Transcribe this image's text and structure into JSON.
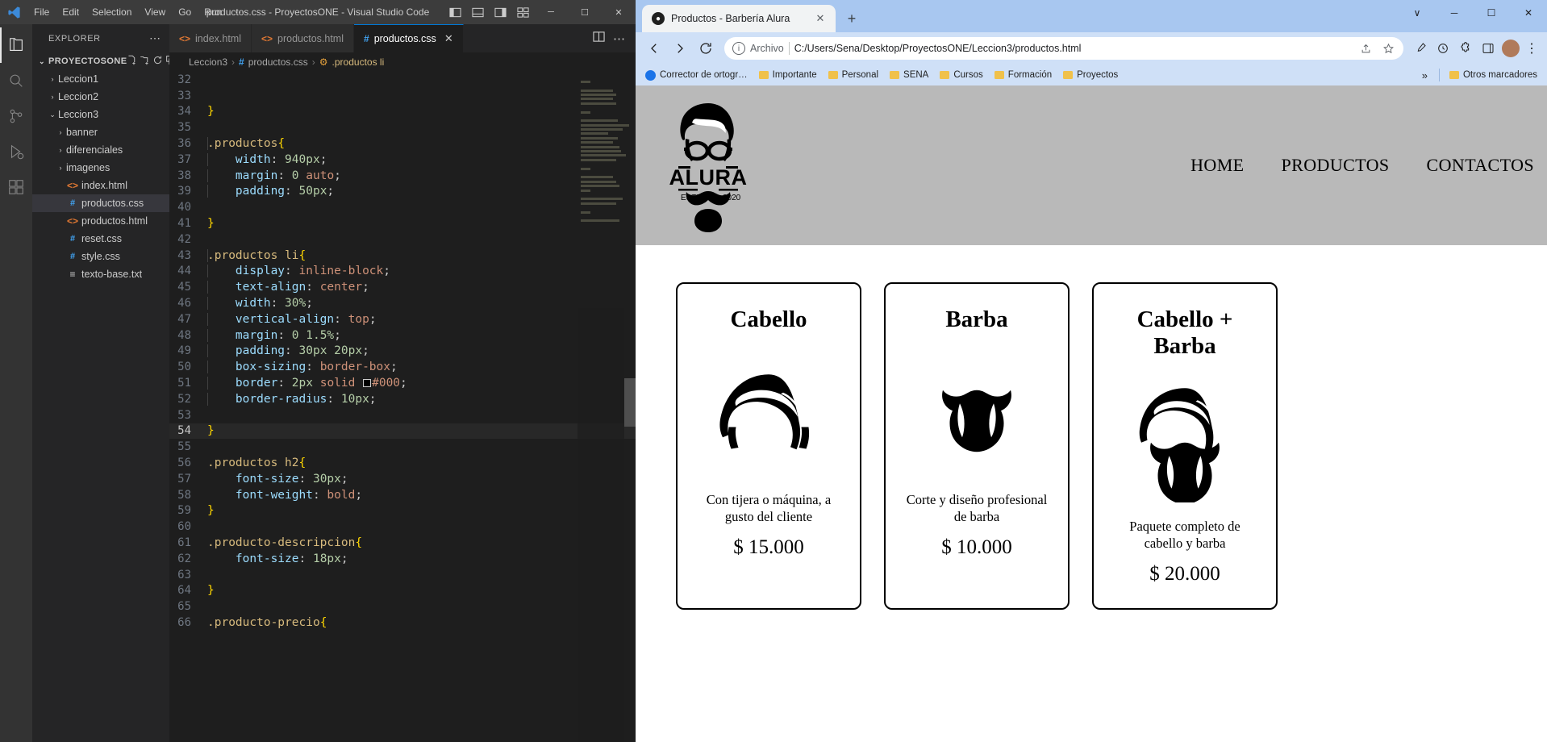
{
  "vscode": {
    "title": "productos.css - ProyectosONE - Visual Studio Code",
    "menu": [
      "File",
      "Edit",
      "Selection",
      "View",
      "Go",
      "Run",
      "⋯"
    ],
    "window_buttons": {
      "minimize": "─",
      "maximize": "☐",
      "close": "✕"
    },
    "activity_items": [
      "explorer-icon",
      "search-icon",
      "source-control-icon",
      "run-debug-icon",
      "extensions-icon"
    ],
    "sidebar": {
      "header": "EXPLORER",
      "header_more": "⋯",
      "section": "PROYECTOSONE",
      "section_chevron": "⌄",
      "tree": [
        {
          "label": "Leccion1",
          "chevron": "›",
          "icon": "",
          "indent": 1,
          "selected": false
        },
        {
          "label": "Leccion2",
          "chevron": "›",
          "icon": "",
          "indent": 1,
          "selected": false
        },
        {
          "label": "Leccion3",
          "chevron": "⌄",
          "icon": "",
          "indent": 1,
          "selected": false
        },
        {
          "label": "banner",
          "chevron": "›",
          "icon": "",
          "indent": 2,
          "selected": false
        },
        {
          "label": "diferenciales",
          "chevron": "›",
          "icon": "",
          "indent": 2,
          "selected": false
        },
        {
          "label": "imagenes",
          "chevron": "›",
          "icon": "",
          "indent": 2,
          "selected": false
        },
        {
          "label": "index.html",
          "chevron": "",
          "icon": "<>",
          "icon_kind": "html",
          "indent": 2,
          "selected": false
        },
        {
          "label": "productos.css",
          "chevron": "",
          "icon": "#",
          "icon_kind": "css",
          "indent": 2,
          "selected": true
        },
        {
          "label": "productos.html",
          "chevron": "",
          "icon": "<>",
          "icon_kind": "html",
          "indent": 2,
          "selected": false
        },
        {
          "label": "reset.css",
          "chevron": "",
          "icon": "#",
          "icon_kind": "css",
          "indent": 2,
          "selected": false
        },
        {
          "label": "style.css",
          "chevron": "",
          "icon": "#",
          "icon_kind": "css",
          "indent": 2,
          "selected": false
        },
        {
          "label": "texto-base.txt",
          "chevron": "",
          "icon": "≡",
          "icon_kind": "txt",
          "indent": 2,
          "selected": false
        }
      ]
    },
    "tabs": [
      {
        "label": "index.html",
        "icon": "<>",
        "kind": "html",
        "active": false,
        "close": ""
      },
      {
        "label": "productos.html",
        "icon": "<>",
        "kind": "html",
        "active": false,
        "close": ""
      },
      {
        "label": "productos.css",
        "icon": "#",
        "kind": "css",
        "active": true,
        "close": "✕"
      }
    ],
    "breadcrumb": {
      "folder": "Leccion3",
      "hash": "#",
      "file": "productos.css",
      "symbol": ".productos li",
      "sep": "›"
    },
    "code": {
      "first_line": 32,
      "current_line": 54,
      "lines": [
        {
          "n": 32,
          "tokens": []
        },
        {
          "n": 33,
          "tokens": []
        },
        {
          "n": 34,
          "tokens": [
            {
              "t": "}",
              "c": "k-brace"
            }
          ]
        },
        {
          "n": 35,
          "tokens": []
        },
        {
          "n": 36,
          "tokens": [
            {
              "t": ".productos",
              "c": "k-sel"
            },
            {
              "t": "{",
              "c": "k-brace"
            }
          ]
        },
        {
          "n": 37,
          "tokens": [
            {
              "t": "    width",
              "c": "k-prop"
            },
            {
              "t": ": ",
              "c": "k-punc"
            },
            {
              "t": "940px",
              "c": "k-num"
            },
            {
              "t": ";",
              "c": "k-punc"
            }
          ]
        },
        {
          "n": 38,
          "tokens": [
            {
              "t": "    margin",
              "c": "k-prop"
            },
            {
              "t": ": ",
              "c": "k-punc"
            },
            {
              "t": "0",
              "c": "k-num"
            },
            {
              "t": " ",
              "c": "k-punc"
            },
            {
              "t": "auto",
              "c": "k-val"
            },
            {
              "t": ";",
              "c": "k-punc"
            }
          ]
        },
        {
          "n": 39,
          "tokens": [
            {
              "t": "    padding",
              "c": "k-prop"
            },
            {
              "t": ": ",
              "c": "k-punc"
            },
            {
              "t": "50px",
              "c": "k-num"
            },
            {
              "t": ";",
              "c": "k-punc"
            }
          ]
        },
        {
          "n": 40,
          "tokens": []
        },
        {
          "n": 41,
          "tokens": [
            {
              "t": "}",
              "c": "k-brace"
            }
          ]
        },
        {
          "n": 42,
          "tokens": []
        },
        {
          "n": 43,
          "tokens": [
            {
              "t": ".productos ",
              "c": "k-sel"
            },
            {
              "t": "li",
              "c": "k-tag"
            },
            {
              "t": "{",
              "c": "k-brace"
            }
          ]
        },
        {
          "n": 44,
          "tokens": [
            {
              "t": "    display",
              "c": "k-prop"
            },
            {
              "t": ": ",
              "c": "k-punc"
            },
            {
              "t": "inline-block",
              "c": "k-val"
            },
            {
              "t": ";",
              "c": "k-punc"
            }
          ]
        },
        {
          "n": 45,
          "tokens": [
            {
              "t": "    text-align",
              "c": "k-prop"
            },
            {
              "t": ": ",
              "c": "k-punc"
            },
            {
              "t": "center",
              "c": "k-val"
            },
            {
              "t": ";",
              "c": "k-punc"
            }
          ]
        },
        {
          "n": 46,
          "tokens": [
            {
              "t": "    width",
              "c": "k-prop"
            },
            {
              "t": ": ",
              "c": "k-punc"
            },
            {
              "t": "30%",
              "c": "k-num"
            },
            {
              "t": ";",
              "c": "k-punc"
            }
          ]
        },
        {
          "n": 47,
          "tokens": [
            {
              "t": "    vertical-align",
              "c": "k-prop"
            },
            {
              "t": ": ",
              "c": "k-punc"
            },
            {
              "t": "top",
              "c": "k-val"
            },
            {
              "t": ";",
              "c": "k-punc"
            }
          ]
        },
        {
          "n": 48,
          "tokens": [
            {
              "t": "    margin",
              "c": "k-prop"
            },
            {
              "t": ": ",
              "c": "k-punc"
            },
            {
              "t": "0 1.5%",
              "c": "k-num"
            },
            {
              "t": ";",
              "c": "k-punc"
            }
          ]
        },
        {
          "n": 49,
          "tokens": [
            {
              "t": "    padding",
              "c": "k-prop"
            },
            {
              "t": ": ",
              "c": "k-punc"
            },
            {
              "t": "30px 20px",
              "c": "k-num"
            },
            {
              "t": ";",
              "c": "k-punc"
            }
          ]
        },
        {
          "n": 50,
          "tokens": [
            {
              "t": "    box-sizing",
              "c": "k-prop"
            },
            {
              "t": ": ",
              "c": "k-punc"
            },
            {
              "t": "border-box",
              "c": "k-val"
            },
            {
              "t": ";",
              "c": "k-punc"
            }
          ]
        },
        {
          "n": 51,
          "tokens": [
            {
              "t": "    border",
              "c": "k-prop"
            },
            {
              "t": ": ",
              "c": "k-punc"
            },
            {
              "t": "2px",
              "c": "k-num"
            },
            {
              "t": " ",
              "c": "k-punc"
            },
            {
              "t": "solid",
              "c": "k-val"
            },
            {
              "t": " ",
              "c": "k-punc"
            },
            {
              "t": "SWATCH",
              "c": "swatch"
            },
            {
              "t": "#000",
              "c": "k-val"
            },
            {
              "t": ";",
              "c": "k-punc"
            }
          ]
        },
        {
          "n": 52,
          "tokens": [
            {
              "t": "    border-radius",
              "c": "k-prop"
            },
            {
              "t": ": ",
              "c": "k-punc"
            },
            {
              "t": "10px",
              "c": "k-num"
            },
            {
              "t": ";",
              "c": "k-punc"
            }
          ]
        },
        {
          "n": 53,
          "tokens": []
        },
        {
          "n": 54,
          "tokens": [
            {
              "t": "}",
              "c": "k-brace"
            }
          ]
        },
        {
          "n": 55,
          "tokens": []
        },
        {
          "n": 56,
          "tokens": [
            {
              "t": ".productos ",
              "c": "k-sel"
            },
            {
              "t": "h2",
              "c": "k-tag"
            },
            {
              "t": "{",
              "c": "k-brace"
            }
          ]
        },
        {
          "n": 57,
          "tokens": [
            {
              "t": "    font-size",
              "c": "k-prop"
            },
            {
              "t": ": ",
              "c": "k-punc"
            },
            {
              "t": "30px",
              "c": "k-num"
            },
            {
              "t": ";",
              "c": "k-punc"
            }
          ]
        },
        {
          "n": 58,
          "tokens": [
            {
              "t": "    font-weight",
              "c": "k-prop"
            },
            {
              "t": ": ",
              "c": "k-punc"
            },
            {
              "t": "bold",
              "c": "k-val"
            },
            {
              "t": ";",
              "c": "k-punc"
            }
          ]
        },
        {
          "n": 59,
          "tokens": [
            {
              "t": "}",
              "c": "k-brace"
            }
          ]
        },
        {
          "n": 60,
          "tokens": []
        },
        {
          "n": 61,
          "tokens": [
            {
              "t": ".producto-descripcion",
              "c": "k-sel"
            },
            {
              "t": "{",
              "c": "k-brace"
            }
          ]
        },
        {
          "n": 62,
          "tokens": [
            {
              "t": "    font-size",
              "c": "k-prop"
            },
            {
              "t": ": ",
              "c": "k-punc"
            },
            {
              "t": "18px",
              "c": "k-num"
            },
            {
              "t": ";",
              "c": "k-punc"
            }
          ]
        },
        {
          "n": 63,
          "tokens": []
        },
        {
          "n": 64,
          "tokens": [
            {
              "t": "}",
              "c": "k-brace"
            }
          ]
        },
        {
          "n": 65,
          "tokens": []
        },
        {
          "n": 66,
          "tokens": [
            {
              "t": ".producto-precio",
              "c": "k-sel"
            },
            {
              "t": "{",
              "c": "k-brace"
            }
          ]
        }
      ]
    }
  },
  "chrome": {
    "tab": {
      "title": "Productos - Barbería Alura",
      "close": "✕"
    },
    "new_tab": "+",
    "window_buttons": {
      "more": "∨",
      "minimize": "─",
      "maximize": "☐",
      "close": "✕"
    },
    "omnibox": {
      "scheme_label": "Archivo",
      "url": "C:/Users/Sena/Desktop/ProyectosONE/Leccion3/productos.html",
      "info_icon": "ⓘ"
    },
    "bookmarks": [
      {
        "label": "Corrector de ortogr…",
        "icon": "globe"
      },
      {
        "label": "Importante",
        "icon": "folder"
      },
      {
        "label": "Personal",
        "icon": "folder"
      },
      {
        "label": "SENA",
        "icon": "folder"
      },
      {
        "label": "Cursos",
        "icon": "folder"
      },
      {
        "label": "Formación",
        "icon": "folder"
      },
      {
        "label": "Proyectos",
        "icon": "folder"
      }
    ],
    "bookmarks_overflow": "»",
    "other_bookmarks": {
      "label": "Otros marcadores",
      "icon": "folder"
    }
  },
  "page": {
    "logo": {
      "brand": "ALURA",
      "estd": "ESTD",
      "year": "2020"
    },
    "nav": [
      "HOME",
      "PRODUCTOS",
      "CONTACTOS"
    ],
    "products": [
      {
        "title": "Cabello",
        "image": "hair-icon",
        "description": "Con tijera o máquina, a gusto del cliente",
        "price": "$ 15.000"
      },
      {
        "title": "Barba",
        "image": "beard-icon",
        "description": "Corte y diseño profesional de barba",
        "price": "$ 10.000"
      },
      {
        "title": "Cabello + Barba",
        "image": "hair-beard-icon",
        "description": "Paquete completo de cabello y barba",
        "price": "$ 20.000"
      }
    ]
  },
  "colors": {
    "vscode_bg": "#1e1e1e",
    "vscode_sidebar": "#252526",
    "chrome_accent": "#a8c7f0",
    "page_header": "#b9b9b9",
    "card_border": "#000000"
  }
}
